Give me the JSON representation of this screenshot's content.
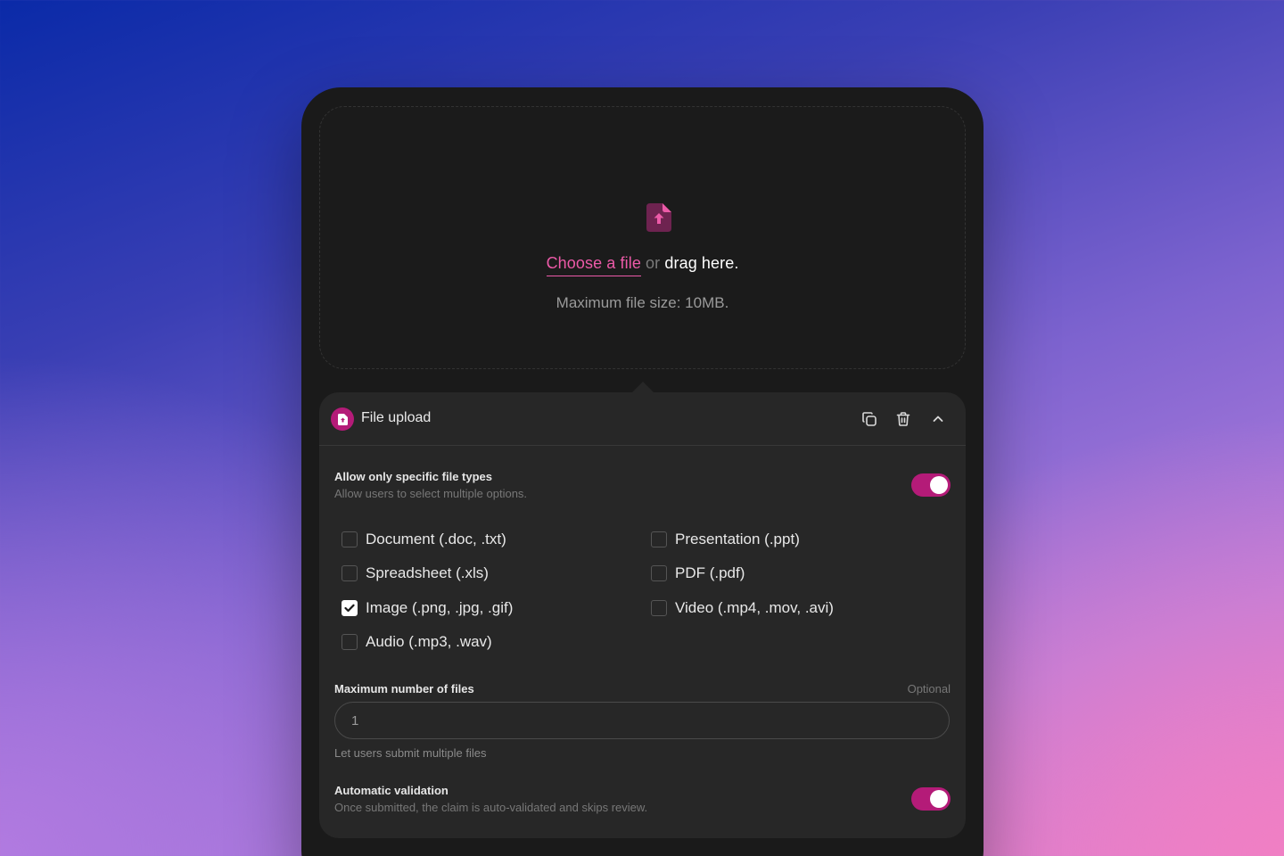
{
  "dropzone": {
    "choose_link": "Choose a file",
    "or_text": "or",
    "drag_text": "drag here.",
    "max_size": "Maximum file size: 10MB."
  },
  "panel": {
    "title": "File upload",
    "accent_color": "#b41b78",
    "header_icons": [
      "duplicate-icon",
      "trash-icon",
      "chevron-up-icon"
    ]
  },
  "file_types": {
    "title": "Allow only specific file types",
    "subtitle": "Allow users to select multiple options.",
    "enabled": true,
    "options": [
      {
        "label": "Document (.doc, .txt)",
        "checked": false
      },
      {
        "label": "Presentation (.ppt)",
        "checked": false
      },
      {
        "label": "Spreadsheet (.xls)",
        "checked": false
      },
      {
        "label": "PDF (.pdf)",
        "checked": false
      },
      {
        "label": "Image (.png, .jpg, .gif)",
        "checked": true
      },
      {
        "label": "Video (.mp4, .mov, .avi)",
        "checked": false
      },
      {
        "label": "Audio (.mp3, .wav)",
        "checked": false
      }
    ]
  },
  "max_files": {
    "label": "Maximum number of files",
    "optional": "Optional",
    "value": "1",
    "help": "Let users submit multiple files"
  },
  "auto_validation": {
    "title": "Automatic validation",
    "subtitle": "Once submitted, the claim is auto-validated and skips review.",
    "enabled": true
  }
}
